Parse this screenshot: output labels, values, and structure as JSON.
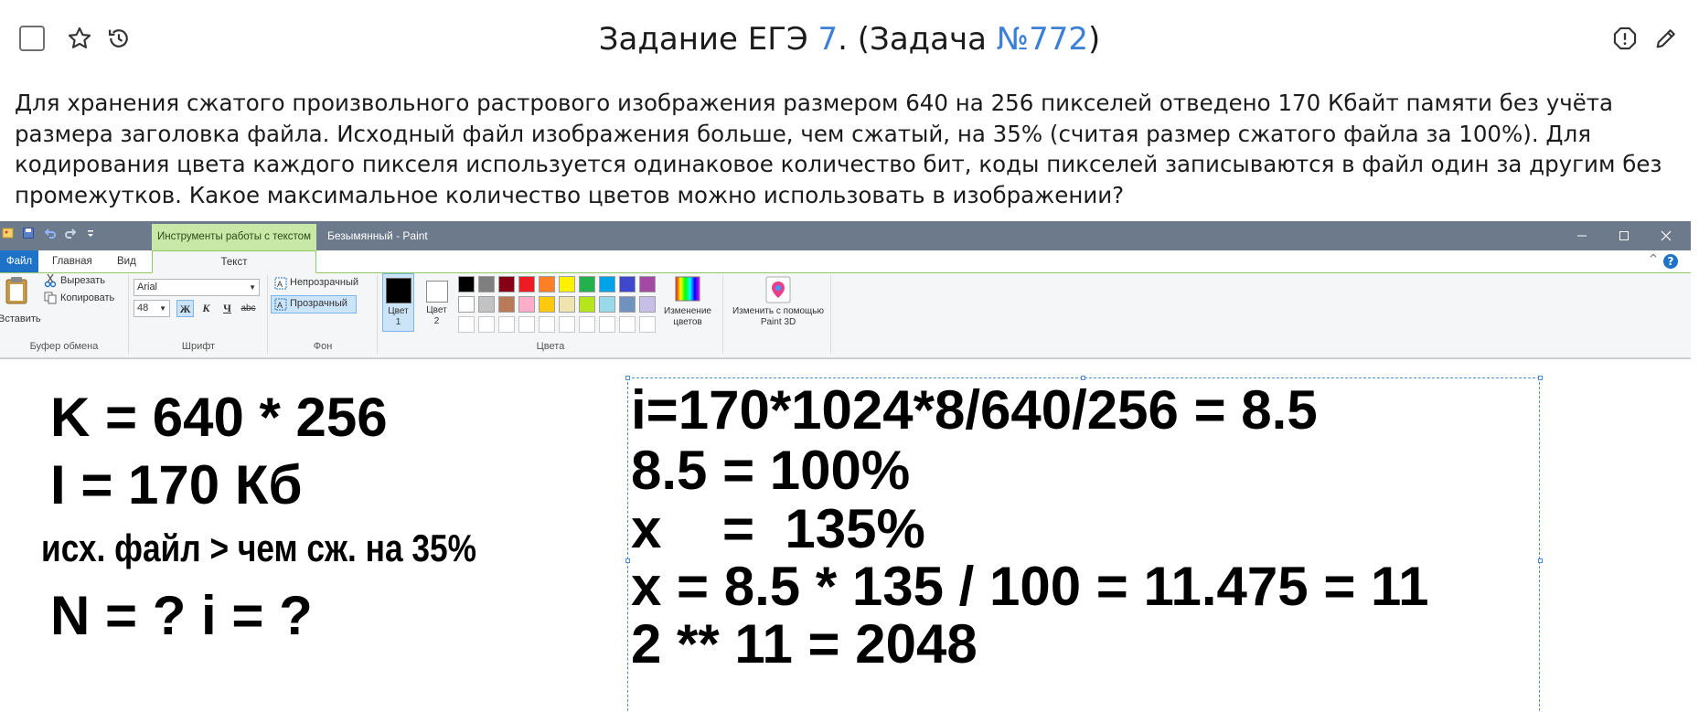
{
  "header": {
    "title_prefix": "Задание ЕГЭ ",
    "task_number": "7",
    "title_middle": ". (Задача ",
    "problem_id": "№772",
    "title_suffix": ")"
  },
  "task": {
    "text": "Для хранения сжатого произвольного растрового изображения размером 640 на 256 пикселей отведено 170 Кбайт памяти без учёта размера заголовка файла. Исходный файл изображения больше, чем сжатый, на 35% (считая размер сжатого файла за 100%). Для кодирования цвета каждого пикселя используется одинаковое количество бит, коды пикселей записываются в файл один за другим без промежутков. Какое максимальное количество цветов можно использовать в изображении?"
  },
  "paint": {
    "context_tab": "Инструменты работы с текстом",
    "window_title": "Безымянный - Paint",
    "tabs": {
      "file": "Файл",
      "home": "Главная",
      "view": "Вид",
      "text": "Текст"
    },
    "clipboard": {
      "paste": "Вставить",
      "cut": "Вырезать",
      "copy": "Копировать",
      "label": "Буфер обмена"
    },
    "font": {
      "family": "Arial",
      "size": "48",
      "bold": "Ж",
      "italic": "К",
      "underline": "Ч",
      "strike": "abc",
      "label": "Шрифт"
    },
    "background": {
      "opaque": "Непрозрачный",
      "transparent": "Прозрачный",
      "label": "Фон"
    },
    "colors": {
      "color1": "Цвет",
      "color1_num": "1",
      "color2": "Цвет",
      "color2_num": "2",
      "edit": "Изменение цветов",
      "label": "Цвета",
      "palette_row1": [
        "#000000",
        "#7f7f7f",
        "#880015",
        "#ed1c24",
        "#ff7f27",
        "#fff200",
        "#22b14c",
        "#00a2e8",
        "#3f48cc",
        "#a349a4"
      ],
      "palette_row2": [
        "#ffffff",
        "#c3c3c3",
        "#b97a57",
        "#ffaec9",
        "#ffc90e",
        "#efe4b0",
        "#b5e61d",
        "#99d9ea",
        "#7092be",
        "#c8bfe7"
      ]
    },
    "paint3d": "Изменить с помощью Paint 3D"
  },
  "canvas": {
    "left_lines": [
      "K = 640 * 256",
      "I = 170 Кб",
      "исх. файл > чем сж. на 35%",
      "N = ? i = ?"
    ],
    "right_lines": [
      "i=170*1024*8/640/256 = 8.5",
      "8.5 = 100%",
      "x    =  135%",
      "x = 8.5 * 135 / 100 = 11.475 = 11",
      "2 ** 11 = 2048"
    ]
  }
}
